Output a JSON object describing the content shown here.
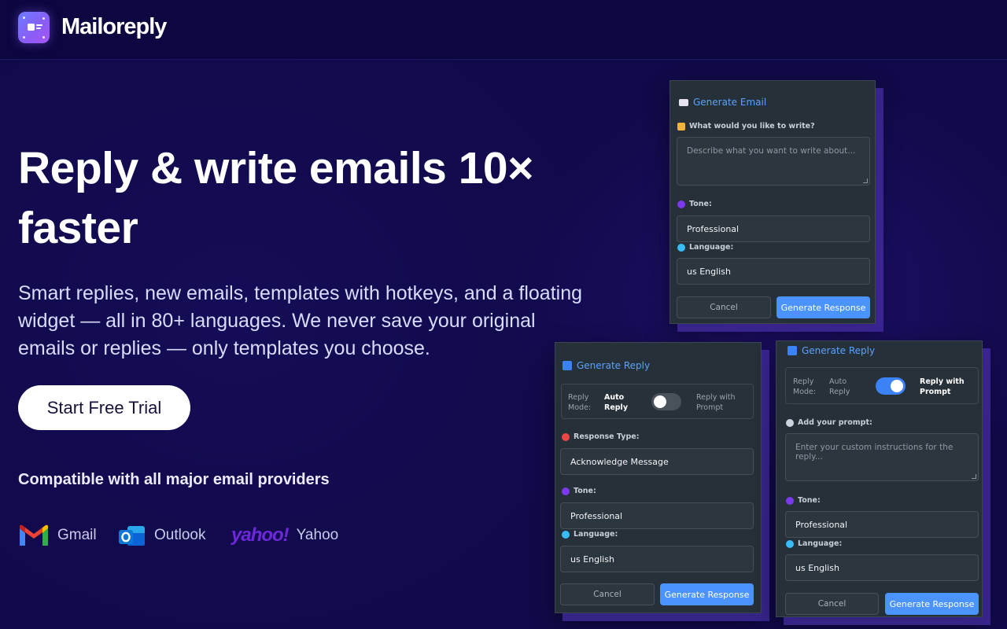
{
  "brand": {
    "name": "Mailoreply"
  },
  "hero": {
    "title": "Reply & write emails 10× faster",
    "subtitle": "Smart replies, new emails, templates with hotkeys, and a floating widget — all in 80+ languages. We never save your original emails or replies — only templates you choose.",
    "cta_label": "Start Free Trial",
    "compat_heading": "Compatible with all major email providers",
    "providers": [
      {
        "name": "Gmail",
        "icon": "gmail-icon"
      },
      {
        "name": "Outlook",
        "icon": "outlook-icon"
      },
      {
        "name": "Yahoo",
        "icon": "yahoo-icon",
        "logo_text": "yahoo!"
      }
    ]
  },
  "colors": {
    "background": "#110a4a",
    "accent": "#4b94ff",
    "panel": "#263038",
    "panel_shadow": "#5a3cc8"
  },
  "generate_email": {
    "title": "Generate Email",
    "prompt_label": "What would you like to write?",
    "prompt_placeholder": "Describe what you want to write about...",
    "tone_label": "Tone:",
    "tone_value": "Professional",
    "language_label": "Language:",
    "language_value": "us English",
    "cancel_label": "Cancel",
    "generate_label": "Generate Response"
  },
  "generate_reply_auto": {
    "title": "Generate Reply",
    "mode_label": "Reply Mode:",
    "mode_auto": "Auto Reply",
    "mode_prompt": "Reply with Prompt",
    "toggle_on": false,
    "response_type_label": "Response Type:",
    "response_type_value": "Acknowledge Message",
    "tone_label": "Tone:",
    "tone_value": "Professional",
    "language_label": "Language:",
    "language_value": "us English",
    "cancel_label": "Cancel",
    "generate_label": "Generate Response"
  },
  "generate_reply_prompt": {
    "title": "Generate Reply",
    "mode_label": "Reply Mode:",
    "mode_auto": "Auto Reply",
    "mode_prompt": "Reply with Prompt",
    "toggle_on": true,
    "prompt_label": "Add your prompt:",
    "prompt_placeholder": "Enter your custom instructions for the reply...",
    "tone_label": "Tone:",
    "tone_value": "Professional",
    "language_label": "Language:",
    "language_value": "us English",
    "cancel_label": "Cancel",
    "generate_label": "Generate Response"
  }
}
